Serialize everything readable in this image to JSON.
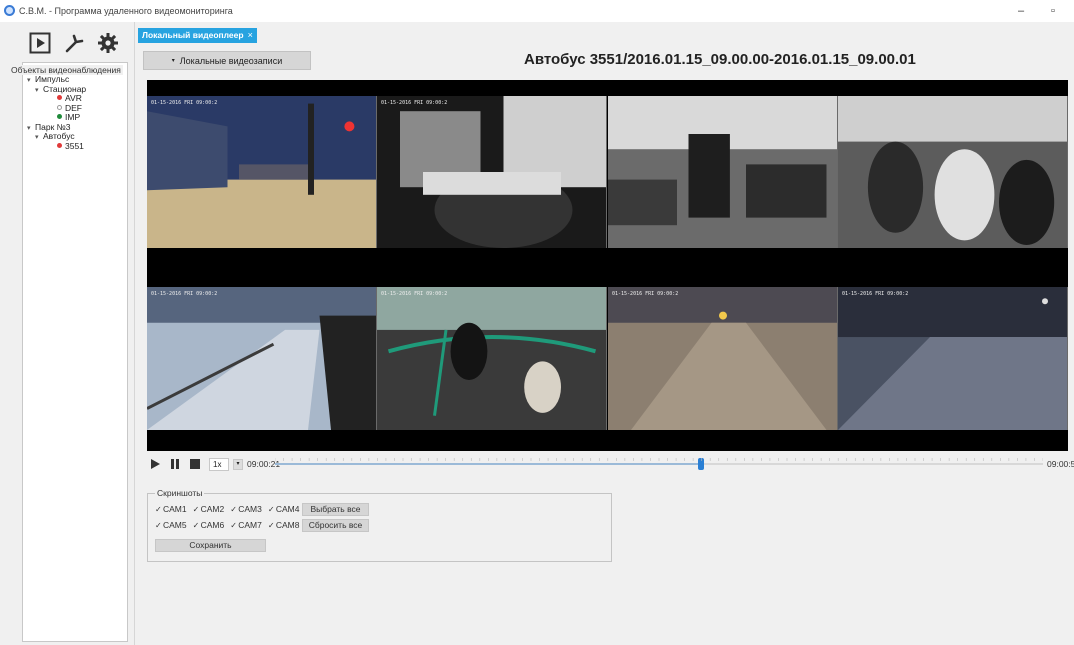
{
  "window": {
    "title": "С.В.М. - Программа удаленного видеомониторинга",
    "minimize_glyph": "–",
    "restore_glyph": "▫"
  },
  "toolbar": {
    "icons": [
      "play-icon",
      "wrench-icon",
      "gear-icon"
    ]
  },
  "sidebar": {
    "header": "Объекты видеонаблюдения",
    "tree": [
      {
        "label": "Импульс",
        "level": 0,
        "expanded": true
      },
      {
        "label": "Стационар",
        "level": 1,
        "expanded": true
      },
      {
        "label": "AVR",
        "level": 2,
        "status": "#e03a3a",
        "status_style": "filled"
      },
      {
        "label": "DEF",
        "level": 2,
        "status": "#9a9a9a",
        "status_style": "hollow"
      },
      {
        "label": "IMP",
        "level": 2,
        "status": "#1f8a3a",
        "status_style": "filled"
      },
      {
        "label": "Парк №3",
        "level": 0,
        "expanded": true
      },
      {
        "label": "Автобус",
        "level": 1,
        "expanded": true
      },
      {
        "label": "3551",
        "level": 2,
        "status": "#e03a3a",
        "status_style": "filled"
      }
    ]
  },
  "tabs": [
    {
      "label": "Локальный видеоплеер",
      "active": true,
      "close": "×"
    }
  ],
  "main": {
    "local_records_label": "Локальные видеозаписи",
    "video_title": "Автобус 3551/2016.01.15_09.00.00-2016.01.15_09.00.01"
  },
  "cameras": [
    {
      "id": "CAM1",
      "osd": "01-15-2016 FRI 09:00:2",
      "scene": "street-night-color"
    },
    {
      "id": "CAM2",
      "osd": "01-15-2016 FRI 09:00:2",
      "scene": "driver-bw"
    },
    {
      "id": "CAM3",
      "osd": "",
      "scene": "cabin-bw"
    },
    {
      "id": "CAM4",
      "osd": "",
      "scene": "cabin-crowd-bw"
    },
    {
      "id": "CAM5",
      "osd": "01-15-2016 FRI 09:00:2",
      "scene": "sidewalk-color"
    },
    {
      "id": "CAM6",
      "osd": "01-15-2016 FRI 09:00:2",
      "scene": "cabin-green-color"
    },
    {
      "id": "CAM7",
      "osd": "01-15-2016 FRI 09:00:2",
      "scene": "road-color"
    },
    {
      "id": "CAM8",
      "osd": "01-15-2016 FRI 09:00:2",
      "scene": "dark-road-color"
    }
  ],
  "player": {
    "speed": "1x",
    "time_start": "09:00:21",
    "time_end": "09:00:5",
    "position_fraction": 0.555
  },
  "screenshots": {
    "legend": "Скриншоты",
    "row1": [
      "CAM1",
      "CAM2",
      "CAM3",
      "CAM4"
    ],
    "row2": [
      "CAM5",
      "CAM6",
      "CAM7",
      "CAM8"
    ],
    "check": "✓",
    "select_all": "Выбрать все",
    "reset_all": "Сбросить все",
    "save": "Сохранить"
  }
}
